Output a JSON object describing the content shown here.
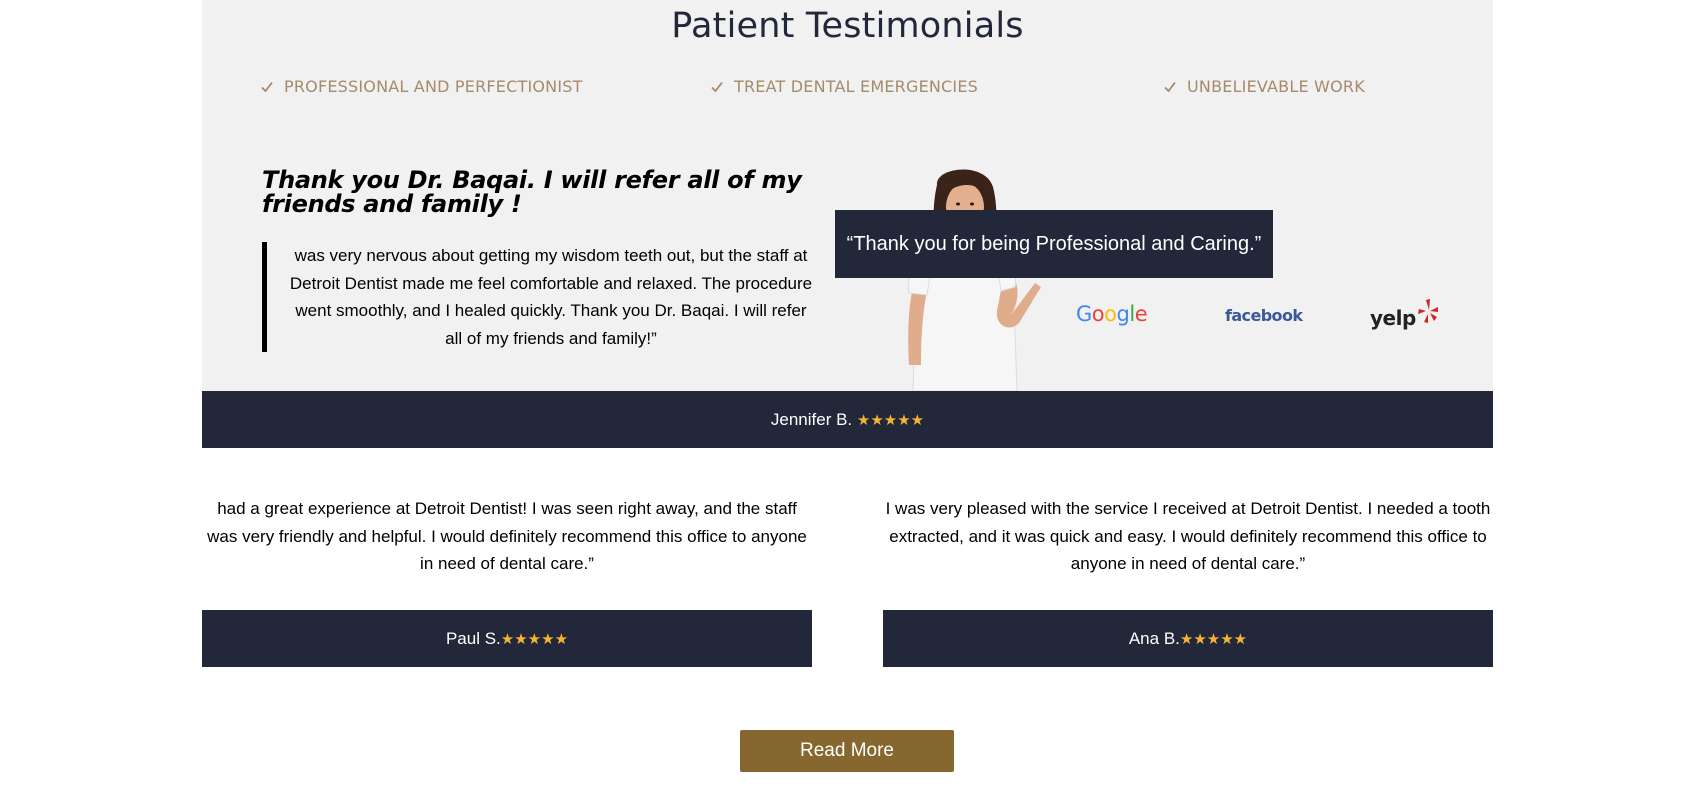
{
  "section": {
    "title": "Patient Testimonials",
    "features": [
      {
        "label": "PROFESSIONAL AND PERFECTIONIST",
        "icon": "check-icon"
      },
      {
        "label": "TREAT DENTAL EMERGENCIES",
        "icon": "check-icon"
      },
      {
        "label": "UNBELIEVABLE WORK",
        "icon": "check-icon"
      }
    ]
  },
  "featured": {
    "heading": "Thank you Dr. Baqai. I will refer all of my friends and family !",
    "quote": "was very nervous about getting my wisdom teeth out, but the staff at Detroit Dentist made me feel comfortable and relaxed. The procedure went smoothly, and I healed quickly. Thank you Dr. Baqai. I will refer all of my friends and family!”",
    "author": "Jennifer B.",
    "stars": "★★★★★"
  },
  "callout": {
    "text": "“Thank you for being Professional and Caring.”"
  },
  "brands": {
    "google": "Google",
    "facebook": "facebook",
    "yelp": "yelp"
  },
  "reviews": [
    {
      "text": "had a great experience at Detroit Dentist! I was seen right away, and the staff was very friendly and helpful. I would definitely recommend this office to anyone in need of dental care.”",
      "author": "Paul S.",
      "stars": "★★★★★"
    },
    {
      "text": "I was very pleased with the service I received at Detroit Dentist. I needed a tooth extracted, and it was quick and easy. I would definitely recommend this office to anyone in need of dental care.”",
      "author": "Ana B.",
      "stars": "★★★★★"
    }
  ],
  "cta": {
    "label": "Read More"
  },
  "colors": {
    "navy": "#22273a",
    "gold": "#85672f",
    "feature_text": "#a58a6c",
    "star": "#f5b432",
    "background_gray": "#f1f1f1"
  }
}
